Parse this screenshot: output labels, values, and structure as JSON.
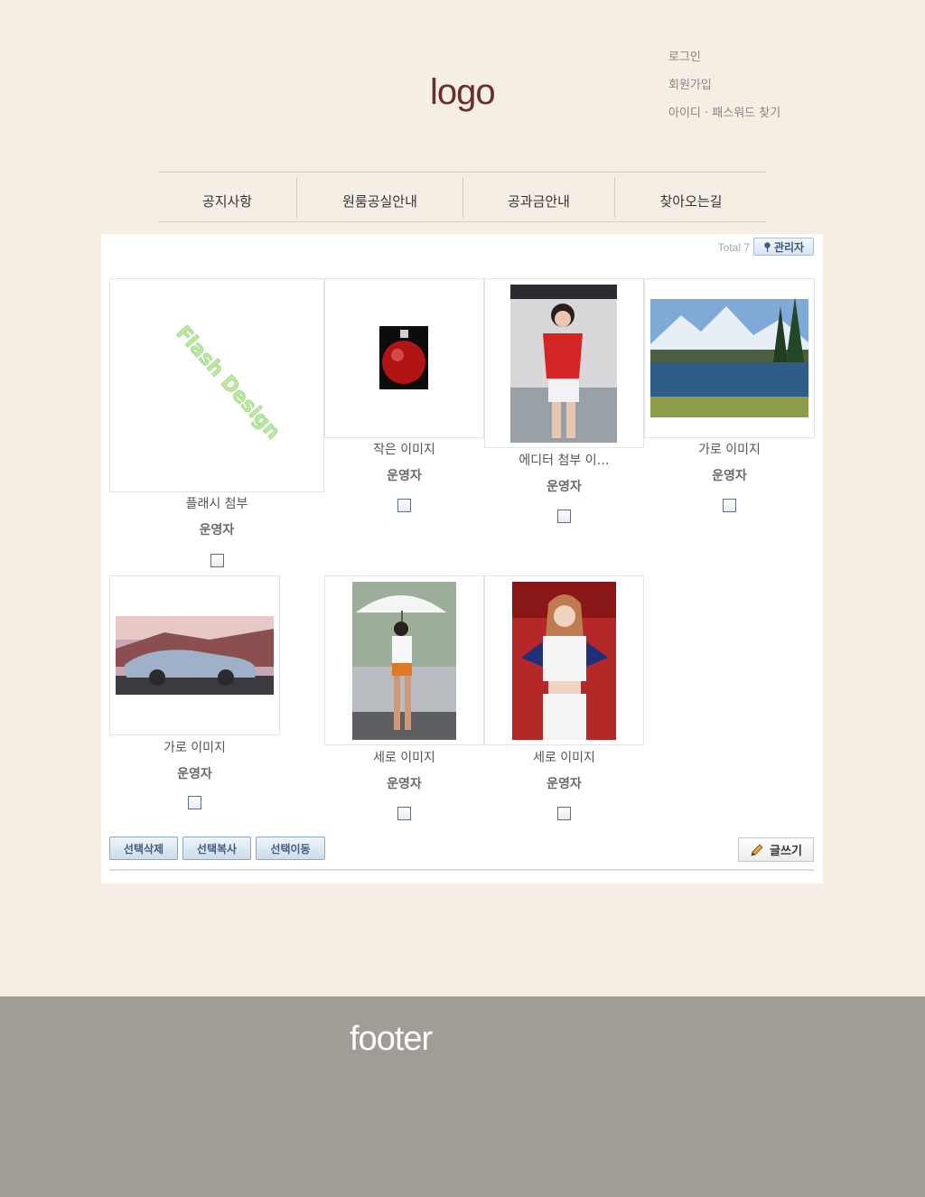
{
  "header": {
    "logo": "logo",
    "links": [
      "로그인",
      "회원가입",
      "아이디 · 패스워드 찾기"
    ]
  },
  "nav": {
    "items": [
      "공지사항",
      "원룸공실안내",
      "공과금안내",
      "찾아오는길"
    ]
  },
  "board": {
    "total_label": "Total 7",
    "admin_label": "관리자",
    "posts": [
      {
        "title": "플래시 첨부",
        "author": "운영자",
        "thumb_text": "Flash Design"
      },
      {
        "title": "작은 이미지",
        "author": "운영자"
      },
      {
        "title": "에디터 첨부 이…",
        "author": "운영자"
      },
      {
        "title": "가로 이미지",
        "author": "운영자"
      },
      {
        "title": "가로 이미지",
        "author": "운영자"
      },
      {
        "title": "세로 이미지",
        "author": "운영자"
      },
      {
        "title": "세로 이미지",
        "author": "운영자"
      }
    ],
    "buttons": {
      "delete": "선택삭제",
      "copy": "선택복사",
      "move": "선택이동",
      "write": "글쓰기"
    }
  },
  "footer": {
    "text": "footer"
  }
}
